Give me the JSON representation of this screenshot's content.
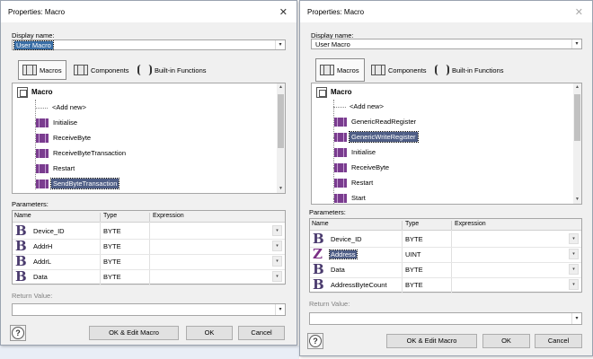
{
  "left": {
    "title": "Properties: Macro",
    "display_name_label": "Display name:",
    "display_name_value": "User Macro",
    "tabs": [
      {
        "label": "Macros",
        "icon": "macro-block-icon"
      },
      {
        "label": "Components",
        "icon": "component-block-icon"
      },
      {
        "label": "Built-in Functions",
        "icon": "builtin-functions-icon"
      }
    ],
    "tree_root": "Macro",
    "tree_add_new": "<Add new>",
    "tree_items": [
      "Initialise",
      "ReceiveByte",
      "ReceiveByteTransaction",
      "Restart",
      "SendByteTransaction"
    ],
    "tree_selected": "SendByteTransaction",
    "parameters_label": "Parameters:",
    "columns": [
      "Name",
      "Type",
      "Expression"
    ],
    "params": [
      {
        "name": "Device_ID",
        "type": "BYTE",
        "icon": "byte-type-icon"
      },
      {
        "name": "AddrH",
        "type": "BYTE",
        "icon": "byte-type-icon"
      },
      {
        "name": "AddrL",
        "type": "BYTE",
        "icon": "byte-type-icon"
      },
      {
        "name": "Data",
        "type": "BYTE",
        "icon": "byte-type-icon"
      }
    ],
    "return_label": "Return Value:",
    "buttons": {
      "ok_edit": "OK & Edit Macro",
      "ok": "OK",
      "cancel": "Cancel"
    }
  },
  "right": {
    "title": "Properties: Macro",
    "display_name_label": "Display name:",
    "display_name_value": "User Macro",
    "tabs": [
      {
        "label": "Macros",
        "icon": "macro-block-icon"
      },
      {
        "label": "Components",
        "icon": "component-block-icon"
      },
      {
        "label": "Built-in Functions",
        "icon": "builtin-functions-icon"
      }
    ],
    "tree_root": "Macro",
    "tree_add_new": "<Add new>",
    "tree_items": [
      "GenericReadRegister",
      "GenericWriteRegister",
      "Initialise",
      "ReceiveByte",
      "Restart",
      "Start"
    ],
    "tree_selected": "GenericWriteRegister",
    "parameters_label": "Parameters:",
    "columns": [
      "Name",
      "Type",
      "Expression"
    ],
    "params": [
      {
        "name": "Device_ID",
        "type": "BYTE",
        "icon": "byte-type-icon"
      },
      {
        "name": "Address",
        "type": "UINT",
        "icon": "uint-type-icon"
      },
      {
        "name": "Data",
        "type": "BYTE",
        "icon": "byte-type-icon"
      },
      {
        "name": "AddressByteCount",
        "type": "BYTE",
        "icon": "byte-type-icon"
      }
    ],
    "param_selected": "Address",
    "return_label": "Return Value:",
    "buttons": {
      "ok_edit": "OK & Edit Macro",
      "ok": "OK",
      "cancel": "Cancel"
    }
  }
}
